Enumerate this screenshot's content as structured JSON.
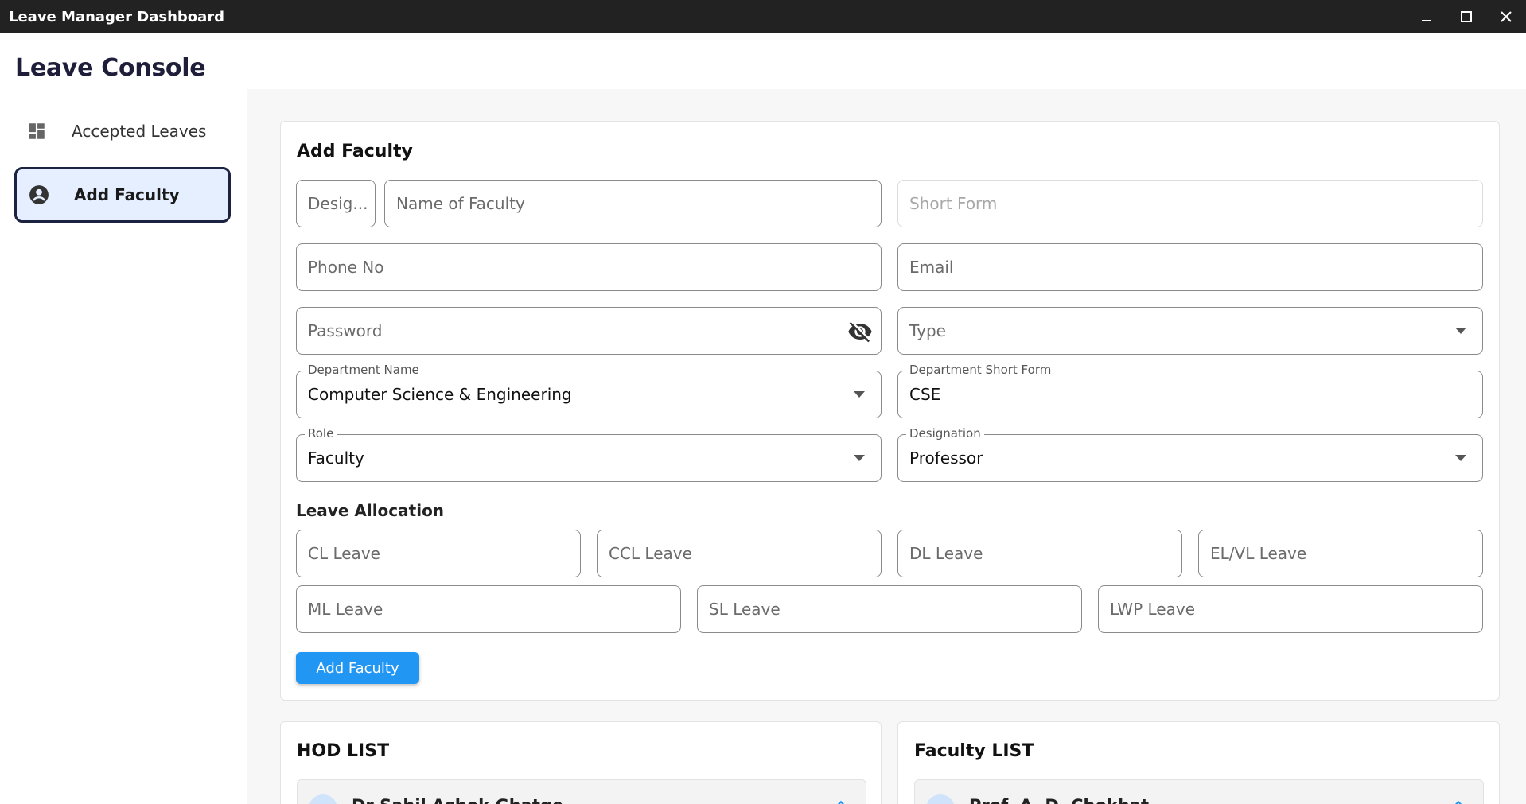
{
  "window": {
    "title": "Leave Manager Dashboard"
  },
  "sidebar": {
    "brand": "Leave Console",
    "items": [
      {
        "label": "Accepted Leaves",
        "icon": "dashboard-icon"
      },
      {
        "label": "Add Faculty",
        "icon": "account-circle-icon",
        "active": true
      }
    ]
  },
  "form": {
    "title": "Add Faculty",
    "prefix_placeholder": "Desig...",
    "name_placeholder": "Name of Faculty",
    "short_form_placeholder": "Short Form",
    "phone_placeholder": "Phone No",
    "email_placeholder": "Email",
    "password_placeholder": "Password",
    "type_placeholder": "Type",
    "department": {
      "label": "Department Name",
      "value": "Computer Science & Engineering"
    },
    "department_short": {
      "label": "Department Short Form",
      "value": "CSE"
    },
    "role": {
      "label": "Role",
      "value": "Faculty"
    },
    "designation": {
      "label": "Designation",
      "value": "Professor"
    },
    "leave_allocation_title": "Leave Allocation",
    "leaves": [
      "CL Leave",
      "CCL Leave",
      "DL Leave",
      "EL/VL Leave",
      "ML Leave",
      "SL Leave",
      "LWP Leave"
    ],
    "submit_label": "Add Faculty"
  },
  "hod_list": {
    "title": "HOD LIST",
    "first_item": "Dr Sahil Ashok Ghatge"
  },
  "faculty_list": {
    "title": "Faculty LIST",
    "first_item": "Prof. A. D. Chokhat"
  },
  "colors": {
    "accent": "#2196f3",
    "active_bg": "#e6efff",
    "titlebar": "#222222"
  }
}
